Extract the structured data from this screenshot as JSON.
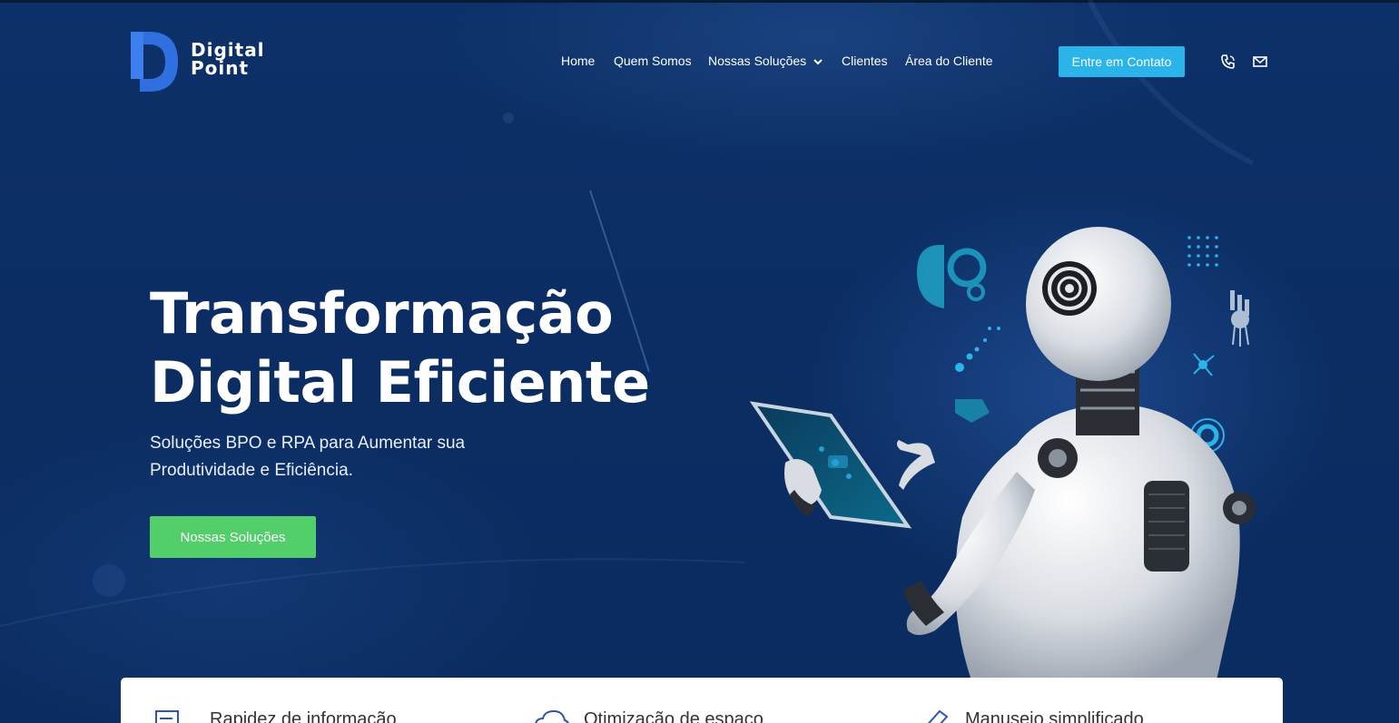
{
  "brand": {
    "line1": "Digital",
    "line2": "Point"
  },
  "nav": {
    "items": [
      "Home",
      "Quem Somos",
      "Nossas Soluções",
      "Clientes",
      "Área do Cliente"
    ],
    "cta": "Entre em Contato"
  },
  "hero": {
    "title_line1": "Transformação",
    "title_line2": "Digital Eficiente",
    "subtitle_line1": "Soluções BPO e RPA para Aumentar sua",
    "subtitle_line2": "Produtividade e Eficiência.",
    "button": "Nossas Soluções"
  },
  "features": [
    "Rapidez de informação",
    "Otimização de espaço",
    "Manuseio simplificado"
  ],
  "colors": {
    "bg": "#0c2f66",
    "accent": "#2ab4ea",
    "green": "#52cf6a",
    "logo_blue": "#2f6fe0"
  },
  "icons": [
    "phone-icon",
    "mail-icon",
    "chevron-down-icon",
    "document-icon",
    "cloud-icon",
    "pen-icon"
  ]
}
